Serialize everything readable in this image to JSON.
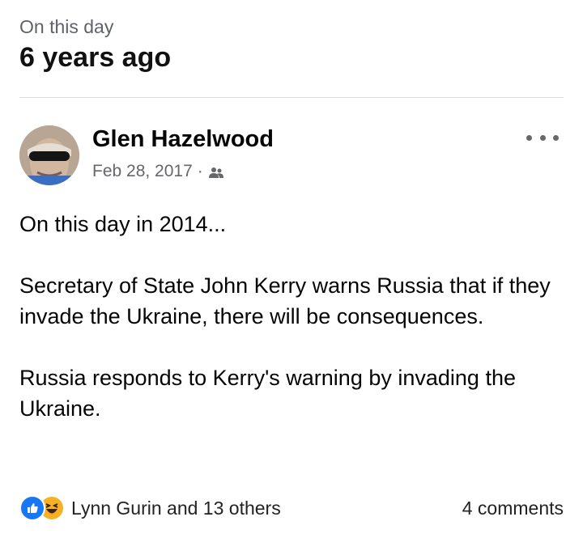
{
  "header": {
    "eyebrow": "On this day",
    "title": "6 years ago"
  },
  "post": {
    "author": "Glen Hazelwood",
    "date": "Feb 28, 2017",
    "separator": "·",
    "audience_icon": "friends-icon",
    "paragraphs": [
      "On this day in 2014...",
      "Secretary of State John Kerry warns Russia that if they invade the Ukraine, there will be consequences.",
      "Russia responds to Kerry's warning by invading the Ukraine."
    ]
  },
  "footer": {
    "reaction_icons": [
      "like-icon",
      "haha-icon"
    ],
    "reactions_label": "Lynn Gurin and 13 others",
    "comments_label": "4 comments"
  },
  "colors": {
    "like": "#1877f2",
    "haha": "#f7b125",
    "meta_text": "#65676b",
    "divider": "#dadde1"
  }
}
